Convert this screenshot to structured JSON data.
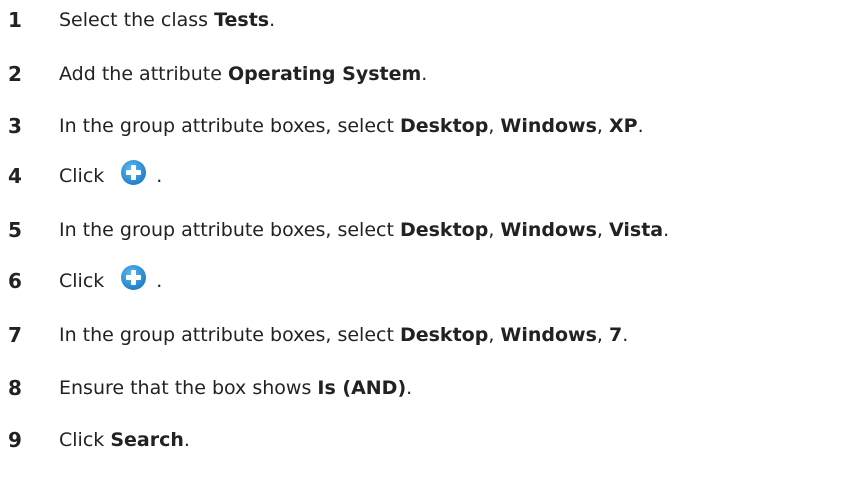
{
  "steps": [
    {
      "num": "1",
      "pre": "Select the class ",
      "b1": "Tests",
      "post": "."
    },
    {
      "num": "2",
      "pre": "Add the attribute ",
      "b1": "Operating System",
      "post": "."
    },
    {
      "num": "3",
      "pre": "In the group attribute boxes, select ",
      "b1": "Desktop",
      "sep1": ", ",
      "b2": "Windows",
      "sep2": ", ",
      "b3": "XP",
      "post": "."
    },
    {
      "num": "4",
      "pre": "Click",
      "icon": "add-circle-icon",
      "post": "."
    },
    {
      "num": "5",
      "pre": "In the group attribute boxes, select ",
      "b1": "Desktop",
      "sep1": ", ",
      "b2": "Windows",
      "sep2": ", ",
      "b3": "Vista",
      "post": "."
    },
    {
      "num": "6",
      "pre": "Click",
      "icon": "add-circle-icon",
      "post": "."
    },
    {
      "num": "7",
      "pre": "In the group attribute boxes, select ",
      "b1": "Desktop",
      "sep1": ", ",
      "b2": "Windows",
      "sep2": ", ",
      "b3": "7",
      "post": "."
    },
    {
      "num": "8",
      "pre": "Ensure that the box shows ",
      "b1": "Is (AND)",
      "post": "."
    },
    {
      "num": "9",
      "pre": "Click ",
      "b1": "Search",
      "post": "."
    }
  ],
  "colors": {
    "text": "#222222",
    "icon_fill": "#2a8fd8",
    "icon_plus": "#ffffff"
  }
}
